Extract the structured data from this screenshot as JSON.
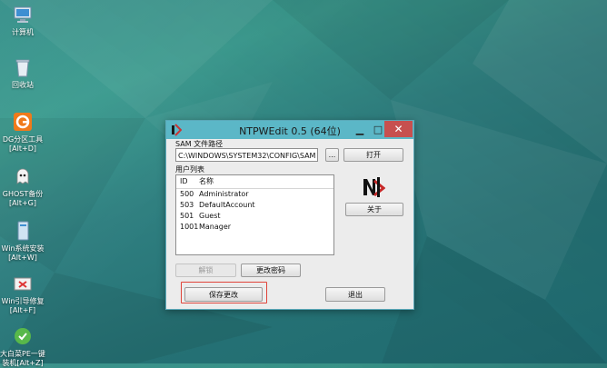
{
  "desktop": {
    "icons": [
      {
        "label": "计算机",
        "icon": "computer-icon"
      },
      {
        "label": "回收站",
        "icon": "recycle-bin-icon"
      },
      {
        "label1": "DG分区工具",
        "label2": "[Alt+D]",
        "icon": "diskgenius-icon"
      },
      {
        "label1": "GHOST备份",
        "label2": "[Alt+G]",
        "icon": "ghost-icon"
      },
      {
        "label1": "Win系统安装",
        "label2": "[Alt+W]",
        "icon": "win-install-icon"
      },
      {
        "label1": "Win引导修复",
        "label2": "[Alt+F]",
        "icon": "boot-repair-icon"
      },
      {
        "label1": "大白菜PE一键",
        "label2": "装机[Alt+Z]",
        "icon": "pe-installer-icon"
      }
    ]
  },
  "window": {
    "title": "NTPWEdit 0.5 (64位)",
    "sam_path_label": "SAM 文件路径",
    "sam_path_value": "C:\\WINDOWS\\SYSTEM32\\CONFIG\\SAM",
    "browse_label": "...",
    "open_label": "打开",
    "user_list_label": "用户列表",
    "columns": {
      "id": "ID",
      "name": "名称"
    },
    "users": [
      {
        "id": "500",
        "name": "Administrator"
      },
      {
        "id": "503",
        "name": "DefaultAccount"
      },
      {
        "id": "501",
        "name": "Guest"
      },
      {
        "id": "1001",
        "name": "Manager"
      }
    ],
    "about_label": "关于",
    "unlock_label": "解锁",
    "change_pw_label": "更改密码",
    "save_label": "保存更改",
    "exit_label": "退出"
  },
  "colors": {
    "titlebar": "#5bb7c7",
    "close_button": "#c7504f",
    "highlight_box": "#e0443a",
    "desktop": "#2f7f80"
  }
}
